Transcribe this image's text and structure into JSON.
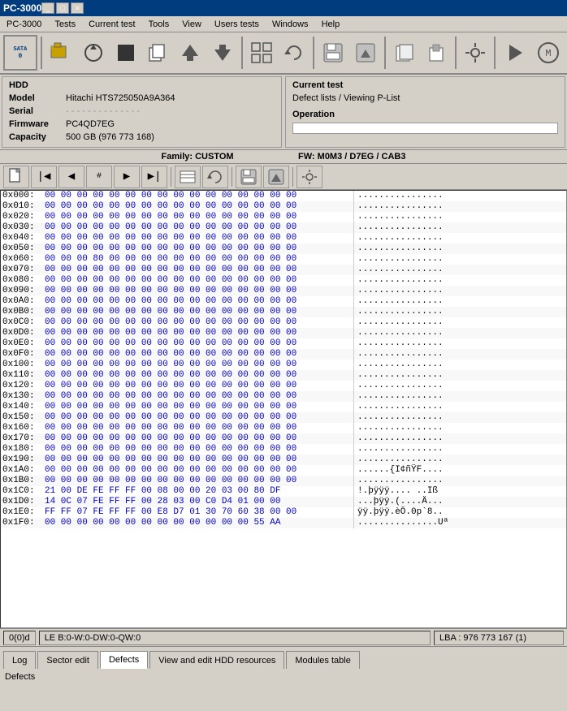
{
  "titleBar": {
    "title": "PC-3000",
    "buttons": [
      "_",
      "□",
      "×"
    ]
  },
  "menuBar": {
    "items": [
      "PC-3000",
      "Tests",
      "Current test",
      "Tools",
      "View",
      "Users tests",
      "Windows",
      "Help"
    ]
  },
  "toolbar": {
    "icons": [
      "💾",
      "🔄",
      "⬛",
      "📋",
      "⬆",
      "⬇",
      "▦",
      "🔧",
      "📄",
      "📋",
      "▶"
    ]
  },
  "infoPanel": {
    "leftTitle": "HDD",
    "model": "Hitachi HTS725050A9A364",
    "serial": "- - - - - - - - - - - - - -",
    "firmware": "PC4QD7EG",
    "capacity": "500 GB (976 773 168)",
    "rightTitle": "Current test",
    "currentTest": "Defect lists / Viewing P-List",
    "operation": "Operation"
  },
  "familyBar": {
    "family": "Family: CUSTOM",
    "fw": "FW: M0M3 / D7EG / CAB3"
  },
  "hexRows": [
    {
      "addr": "0x000:",
      "bytes": "00 00 00 00 00 00 00 00 00 00 00 00 00 00 00 00",
      "ascii": "................"
    },
    {
      "addr": "0x010:",
      "bytes": "00 00 00 00 00 00 00 00 00 00 00 00 00 00 00 00",
      "ascii": "................"
    },
    {
      "addr": "0x020:",
      "bytes": "00 00 00 00 00 00 00 00 00 00 00 00 00 00 00 00",
      "ascii": "................"
    },
    {
      "addr": "0x030:",
      "bytes": "00 00 00 00 00 00 00 00 00 00 00 00 00 00 00 00",
      "ascii": "................"
    },
    {
      "addr": "0x040:",
      "bytes": "00 00 00 00 00 00 00 00 00 00 00 00 00 00 00 00",
      "ascii": "................"
    },
    {
      "addr": "0x050:",
      "bytes": "00 00 00 00 00 00 00 00 00 00 00 00 00 00 00 00",
      "ascii": "................"
    },
    {
      "addr": "0x060:",
      "bytes": "00 00 00 80 00 00 00 00 00 00 00 00 00 00 00 00",
      "ascii": "................"
    },
    {
      "addr": "0x070:",
      "bytes": "00 00 00 00 00 00 00 00 00 00 00 00 00 00 00 00",
      "ascii": "................"
    },
    {
      "addr": "0x080:",
      "bytes": "00 00 00 00 00 00 00 00 00 00 00 00 00 00 00 00",
      "ascii": "................"
    },
    {
      "addr": "0x090:",
      "bytes": "00 00 00 00 00 00 00 00 00 00 00 00 00 00 00 00",
      "ascii": "................"
    },
    {
      "addr": "0x0A0:",
      "bytes": "00 00 00 00 00 00 00 00 00 00 00 00 00 00 00 00",
      "ascii": "................"
    },
    {
      "addr": "0x0B0:",
      "bytes": "00 00 00 00 00 00 00 00 00 00 00 00 00 00 00 00",
      "ascii": "................"
    },
    {
      "addr": "0x0C0:",
      "bytes": "00 00 00 00 00 00 00 00 00 00 00 00 00 00 00 00",
      "ascii": "................"
    },
    {
      "addr": "0x0D0:",
      "bytes": "00 00 00 00 00 00 00 00 00 00 00 00 00 00 00 00",
      "ascii": "................"
    },
    {
      "addr": "0x0E0:",
      "bytes": "00 00 00 00 00 00 00 00 00 00 00 00 00 00 00 00",
      "ascii": "................"
    },
    {
      "addr": "0x0F0:",
      "bytes": "00 00 00 00 00 00 00 00 00 00 00 00 00 00 00 00",
      "ascii": "................"
    },
    {
      "addr": "0x100:",
      "bytes": "00 00 00 00 00 00 00 00 00 00 00 00 00 00 00 00",
      "ascii": "................"
    },
    {
      "addr": "0x110:",
      "bytes": "00 00 00 00 00 00 00 00 00 00 00 00 00 00 00 00",
      "ascii": "................"
    },
    {
      "addr": "0x120:",
      "bytes": "00 00 00 00 00 00 00 00 00 00 00 00 00 00 00 00",
      "ascii": "................"
    },
    {
      "addr": "0x130:",
      "bytes": "00 00 00 00 00 00 00 00 00 00 00 00 00 00 00 00",
      "ascii": "................"
    },
    {
      "addr": "0x140:",
      "bytes": "00 00 00 00 00 00 00 00 00 00 00 00 00 00 00 00",
      "ascii": "................"
    },
    {
      "addr": "0x150:",
      "bytes": "00 00 00 00 00 00 00 00 00 00 00 00 00 00 00 00",
      "ascii": "................"
    },
    {
      "addr": "0x160:",
      "bytes": "00 00 00 00 00 00 00 00 00 00 00 00 00 00 00 00",
      "ascii": "................"
    },
    {
      "addr": "0x170:",
      "bytes": "00 00 00 00 00 00 00 00 00 00 00 00 00 00 00 00",
      "ascii": "................"
    },
    {
      "addr": "0x180:",
      "bytes": "00 00 00 00 00 00 00 00 00 00 00 00 00 00 00 00",
      "ascii": "................"
    },
    {
      "addr": "0x190:",
      "bytes": "00 00 00 00 00 00 00 00 00 00 00 00 00 00 00 00",
      "ascii": "................"
    },
    {
      "addr": "0x1A0:",
      "bytes": "00 00 00 00 00 00 00 00 00 00 00 00 00 00 00 00",
      "ascii": "......{I¢ñŸF...."
    },
    {
      "addr": "0x1B0:",
      "bytes": "00 00 00 00 00 00 00 00 00 00 00 00 00 00 00 00",
      "ascii": "................"
    },
    {
      "addr": "0x1C0:",
      "bytes": "21 00 DE FE FF FF 00 08 00 00 20 03 00 80 DF",
      "ascii": "!.þÿÿÿ.... ..Iß"
    },
    {
      "addr": "0x1D0:",
      "bytes": "14 0C 07 FE FF FF 00 28 03 00 C0 D4 01 00 00",
      "ascii": "...þÿÿ.(....Ä..."
    },
    {
      "addr": "0x1E0:",
      "bytes": "FF FF 07 FE FF FF 00 E8 D7 01 30 70 60 38 00 00",
      "ascii": "ÿÿ.þÿÿ.èÖ.0p`8.."
    },
    {
      "addr": "0x1F0:",
      "bytes": "00 00 00 00 00 00 00 00 00 00 00 00 00 55 AA",
      "ascii": "...............Uª"
    }
  ],
  "statusBar": {
    "left": "0(0)d",
    "center": "LE B:0-W:0-DW:0-QW:0",
    "right": "LBA : 976 773 167 (1)"
  },
  "tabs": [
    {
      "label": "Log",
      "active": false
    },
    {
      "label": "Sector edit",
      "active": false
    },
    {
      "label": "Defects",
      "active": true
    },
    {
      "label": "View and edit HDD resources",
      "active": false
    },
    {
      "label": "Modules table",
      "active": false
    }
  ],
  "bottomLabel": "Defects"
}
